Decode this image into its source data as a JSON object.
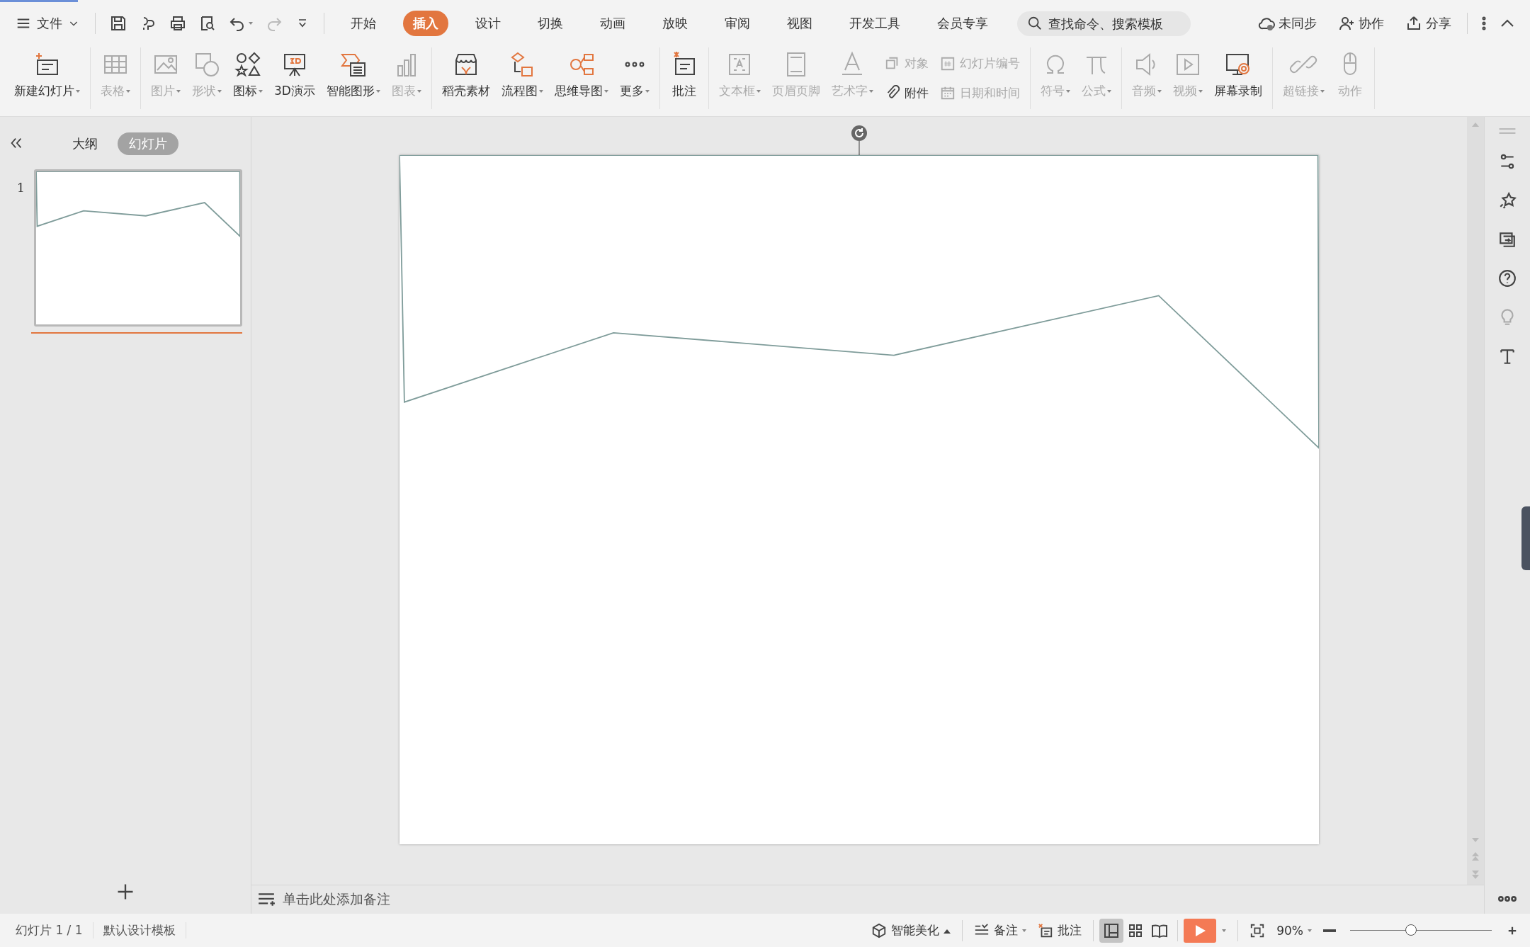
{
  "menu": {
    "file_label": "文件",
    "tabs": [
      {
        "label": "开始",
        "selected": false
      },
      {
        "label": "插入",
        "selected": true
      },
      {
        "label": "设计",
        "selected": false
      },
      {
        "label": "切换",
        "selected": false
      },
      {
        "label": "动画",
        "selected": false
      },
      {
        "label": "放映",
        "selected": false
      },
      {
        "label": "审阅",
        "selected": false
      },
      {
        "label": "视图",
        "selected": false
      },
      {
        "label": "开发工具",
        "selected": false
      },
      {
        "label": "会员专享",
        "selected": false
      }
    ],
    "search": {
      "placeholder": "查找命令、搜索模板"
    },
    "actions": [
      "未同步",
      "协作",
      "分享"
    ]
  },
  "ribbon": {
    "groups": [
      {
        "items": [
          {
            "kind": "large",
            "label": "新建幻灯片",
            "disabled": false,
            "dropdown": true
          }
        ]
      },
      {
        "items": [
          {
            "kind": "large",
            "label": "表格",
            "disabled": true,
            "dropdown": true
          }
        ]
      },
      {
        "items": [
          {
            "kind": "large",
            "label": "图片",
            "disabled": true,
            "dropdown": true
          },
          {
            "kind": "large",
            "label": "形状",
            "disabled": true,
            "dropdown": true
          },
          {
            "kind": "large",
            "label": "图标",
            "disabled": false,
            "dropdown": true
          },
          {
            "kind": "large",
            "label": "3D演示",
            "disabled": false,
            "dropdown": false
          },
          {
            "kind": "large",
            "label": "智能图形",
            "disabled": false,
            "dropdown": true
          },
          {
            "kind": "large",
            "label": "图表",
            "disabled": true,
            "dropdown": true
          }
        ]
      },
      {
        "items": [
          {
            "kind": "large",
            "label": "稻壳素材",
            "disabled": false,
            "dropdown": false
          },
          {
            "kind": "large",
            "label": "流程图",
            "disabled": false,
            "dropdown": true
          },
          {
            "kind": "large",
            "label": "思维导图",
            "disabled": false,
            "dropdown": true
          },
          {
            "kind": "large",
            "label": "更多",
            "disabled": false,
            "dropdown": true
          }
        ]
      },
      {
        "items": [
          {
            "kind": "large",
            "label": "批注",
            "disabled": false,
            "dropdown": false
          }
        ]
      },
      {
        "items": [
          {
            "kind": "large",
            "label": "文本框",
            "disabled": true,
            "dropdown": true
          },
          {
            "kind": "large",
            "label": "页眉页脚",
            "disabled": true,
            "dropdown": false
          },
          {
            "kind": "large",
            "label": "艺术字",
            "disabled": true,
            "dropdown": true
          },
          {
            "kind": "stack",
            "items": [
              {
                "label": "对象",
                "disabled": true
              },
              {
                "label": "附件",
                "disabled": false
              }
            ]
          },
          {
            "kind": "stack",
            "items": [
              {
                "label": "幻灯片编号",
                "disabled": true
              },
              {
                "label": "日期和时间",
                "disabled": true
              }
            ]
          }
        ]
      },
      {
        "items": [
          {
            "kind": "large",
            "label": "符号",
            "disabled": true,
            "dropdown": true
          },
          {
            "kind": "large",
            "label": "公式",
            "disabled": true,
            "dropdown": true
          }
        ]
      },
      {
        "items": [
          {
            "kind": "large",
            "label": "音频",
            "disabled": true,
            "dropdown": true
          },
          {
            "kind": "large",
            "label": "视频",
            "disabled": true,
            "dropdown": true
          },
          {
            "kind": "large",
            "label": "屏幕录制",
            "disabled": false,
            "dropdown": false
          }
        ]
      },
      {
        "items": [
          {
            "kind": "large",
            "label": "超链接",
            "disabled": true,
            "dropdown": true
          },
          {
            "kind": "large",
            "label": "动作",
            "disabled": true,
            "dropdown": false
          }
        ]
      }
    ]
  },
  "panel": {
    "tabs": [
      {
        "label": "大纲",
        "selected": false
      },
      {
        "label": "幻灯片",
        "selected": true
      }
    ],
    "slides": [
      {
        "number": "1",
        "selected": true
      }
    ]
  },
  "notes": {
    "placeholder": "单击此处添加备注"
  },
  "status_bar": {
    "left": [
      "幻灯片 1 / 1",
      "默认设计模板"
    ],
    "beautify": "智能美化",
    "notes": "备注",
    "comments": "批注",
    "views": [
      {
        "selected": true
      },
      {
        "selected": false
      },
      {
        "selected": false
      }
    ],
    "zoom": "90%",
    "zoom_slider": {
      "level": 0.43
    }
  }
}
